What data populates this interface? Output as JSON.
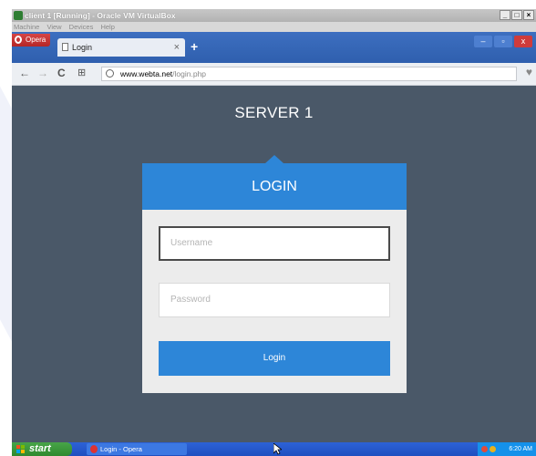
{
  "vbox": {
    "title": "client 1 [Running] - Oracle VM VirtualBox",
    "menu": [
      "Machine",
      "View",
      "Devices",
      "Help"
    ],
    "controls": [
      "_",
      "□",
      "×"
    ]
  },
  "browser": {
    "menu_label": "Opera",
    "tab_title": "Login",
    "tab_close": "×",
    "new_tab": "+",
    "window_controls": {
      "min": "–",
      "max": "▫",
      "close": "x"
    },
    "nav": {
      "back": "←",
      "forward": "→",
      "reload": "C",
      "speed_dial": "⊞"
    },
    "url_domain": "www.webta.net",
    "url_path": "/login.php",
    "heart": "♥"
  },
  "page": {
    "server_title": "SERVER 1",
    "login_header": "LOGIN",
    "username_placeholder": "Username",
    "password_placeholder": "Password",
    "login_button": "Login"
  },
  "taskbar": {
    "start_label": "start",
    "task_label": "Login - Opera",
    "clock": "6:20 AM"
  },
  "colors": {
    "page_bg": "#4a5868",
    "accent_blue": "#2d86d8",
    "opera_tabbar": "#3d6fc0",
    "xp_start_green": "#48a448"
  }
}
